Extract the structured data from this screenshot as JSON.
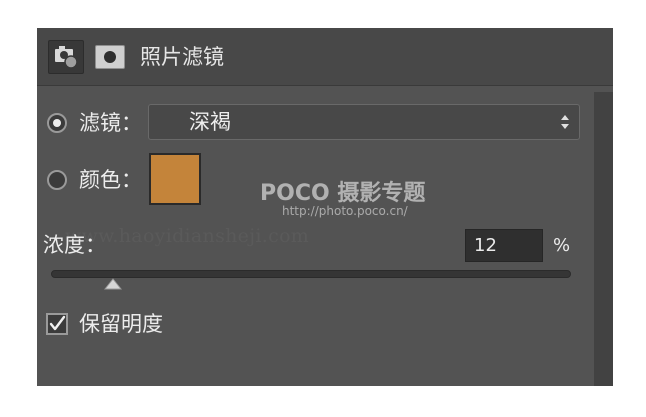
{
  "header": {
    "title": "照片滤镜",
    "adjustment_icon": "camera-filter-icon",
    "mask_icon": "layer-mask-icon"
  },
  "filter": {
    "label": "滤镜：",
    "value": "深褐",
    "selected": true
  },
  "color": {
    "label": "颜色：",
    "swatch_hex": "#c4843a",
    "selected": false
  },
  "density": {
    "label": "浓度：",
    "value": "12",
    "unit": "%",
    "level_percent": 12
  },
  "preserve_luminosity": {
    "label": "保留明度",
    "checked": true
  },
  "watermarks": {
    "logo": "POCO 摄影专题",
    "url": "http://photo.poco.cn/",
    "site": "www.haoyidiansheji.com"
  },
  "colors": {
    "panel": "#535353",
    "header": "#484848",
    "swatch": "#c4843a"
  }
}
